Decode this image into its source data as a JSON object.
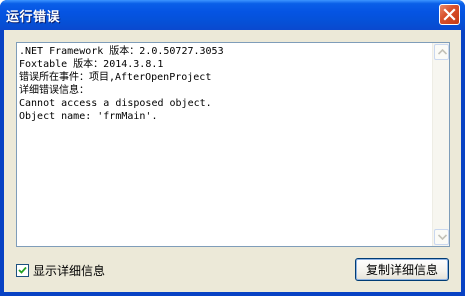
{
  "window": {
    "title": "运行错误"
  },
  "error": {
    "lines": [
      ".NET Framework 版本：2.0.50727.3053",
      "Foxtable 版本：2014.3.8.1",
      "错误所在事件：项目,AfterOpenProject",
      "详细错误信息：",
      "Cannot access a disposed object.",
      "Object name: 'frmMain'."
    ]
  },
  "footer": {
    "show_details_label": "显示详细信息",
    "show_details_checked": true,
    "copy_button_label": "复制详细信息"
  },
  "icons": {
    "close": "close-icon",
    "scroll_up": "scroll-up-arrow-icon",
    "scroll_down": "scroll-down-arrow-icon",
    "check": "checkmark-icon"
  },
  "colors": {
    "titlebar": "#0554e3",
    "close_button": "#d9512c",
    "dialog_background": "#ece9d8"
  }
}
